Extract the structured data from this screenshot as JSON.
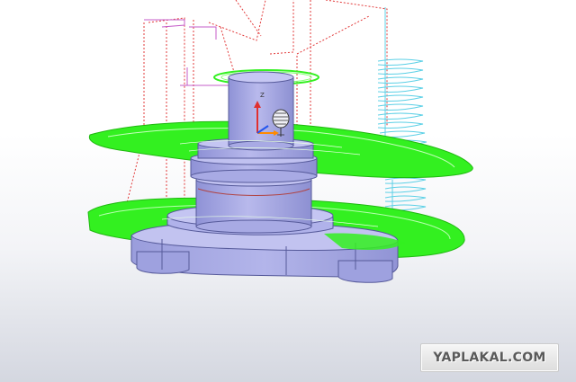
{
  "viewport": {
    "background_top": "#ffffff",
    "background_bottom": "#d4d7e0"
  },
  "colors": {
    "part_body": "#a7a9e0",
    "part_edge": "#565a9a",
    "toolpath_green": "#33f020",
    "toolpath_red": "#e23a3a",
    "toolpath_magenta": "#c45cc9",
    "toolpath_cyan": "#5cd0e6"
  },
  "triad": {
    "axis_z_label": "Z",
    "axis_z_color": "#e03030",
    "axis_x_color": "#ff8a00",
    "axis_y_color": "#2255ee",
    "tool_icon": "drill-bit-icon"
  },
  "watermark": {
    "text": "YAPLAKAL.COM"
  }
}
